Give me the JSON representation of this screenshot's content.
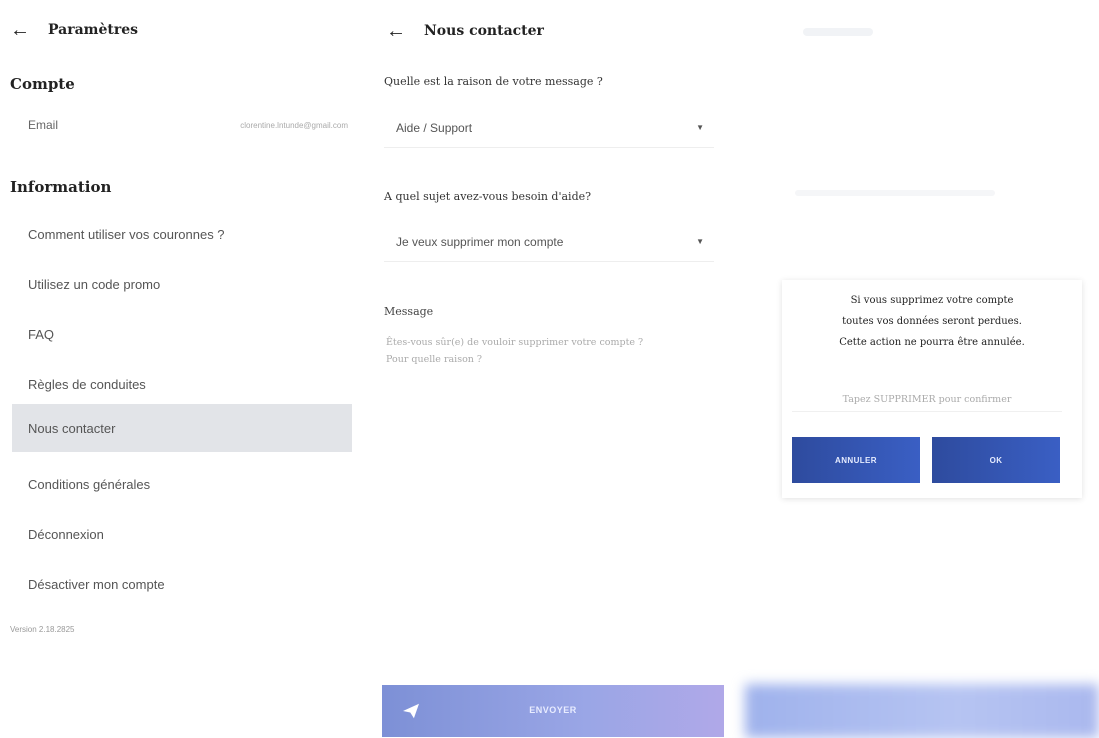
{
  "settings": {
    "title": "Paramètres",
    "account_section": "Compte",
    "email_label": "Email",
    "email_value": "clorentine.lntunde@gmail.com",
    "information_section": "Information",
    "menu": [
      {
        "label": "Comment utiliser vos couronnes ?",
        "active": false
      },
      {
        "label": "Utilisez un code promo",
        "active": false
      },
      {
        "label": "FAQ",
        "active": false
      },
      {
        "label": "Règles de conduites",
        "active": false
      },
      {
        "label": "Nous contacter",
        "active": true
      },
      {
        "label": "Conditions générales",
        "active": false
      },
      {
        "label": "Déconnexion",
        "active": false
      },
      {
        "label": "Désactiver mon compte",
        "active": false
      }
    ],
    "version": "Version 2.18.2825"
  },
  "contact": {
    "title": "Nous contacter",
    "reason_question": "Quelle est la raison de votre message ?",
    "reason_value": "Aide / Support",
    "subject_question": "A quel sujet avez-vous besoin d'aide?",
    "subject_value": "Je veux supprimer mon compte",
    "message_label": "Message",
    "message_text": "Êtes-vous sûr(e) de vouloir supprimer votre compte ?\n Pour quelle raison ?",
    "send_label": "ENVOYER"
  },
  "dialog": {
    "text": "Si vous supprimez votre compte\ntoutes vos données seront perdues.\nCette action ne pourra être annulée.",
    "input_placeholder": "Tapez SUPPRIMER pour confirmer",
    "cancel_label": "ANNULER",
    "ok_label": "OK"
  },
  "colors": {
    "active_item_bg": "#e2e4e8",
    "button_primary": "#2e4b9e",
    "send_button": "#8fa0e0"
  }
}
